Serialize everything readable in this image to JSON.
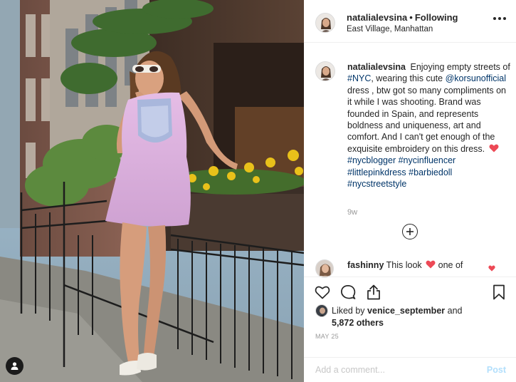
{
  "post": {
    "author": "natalialevsina",
    "follow_state": "Following",
    "separator": "•",
    "location": "East Village, Manhattan"
  },
  "caption": {
    "username": "natalialevsina",
    "part1": "Enjoying empty streets of",
    "hashtag_nyc": "#NYC",
    "part2": ", wearing this cute",
    "mention": "@korsunofficial",
    "part3": "dress , btw got so many compliments on it while I was shooting. Brand was founded in Spain, and represents boldness and uniqueness, art and comfort. And I can't get enough of the exquisite embroidery on this dress.",
    "hashtags": [
      "#nycblogger",
      "#nycinfluencer",
      "#littlepinkdress",
      "#barbiedoll",
      "#nycstreetstyle"
    ],
    "age": "9w"
  },
  "comment": {
    "username": "fashinny",
    "text": "This look",
    "text_after": "one of"
  },
  "likes": {
    "prefix": "Liked by",
    "user": "venice_september",
    "joiner": "and",
    "count": "5,872 others"
  },
  "date": "MAY 25",
  "add_comment": {
    "placeholder": "Add a comment...",
    "post_label": "Post"
  },
  "colors": {
    "accent_link": "#003569",
    "heart_red": "#ed4956",
    "post_disabled": "#b2dffc",
    "muted": "#999999"
  },
  "icons": [
    "more-options-icon",
    "plus-circle-icon",
    "heart-icon",
    "comment-icon",
    "share-icon",
    "bookmark-icon",
    "user-tag-icon"
  ]
}
